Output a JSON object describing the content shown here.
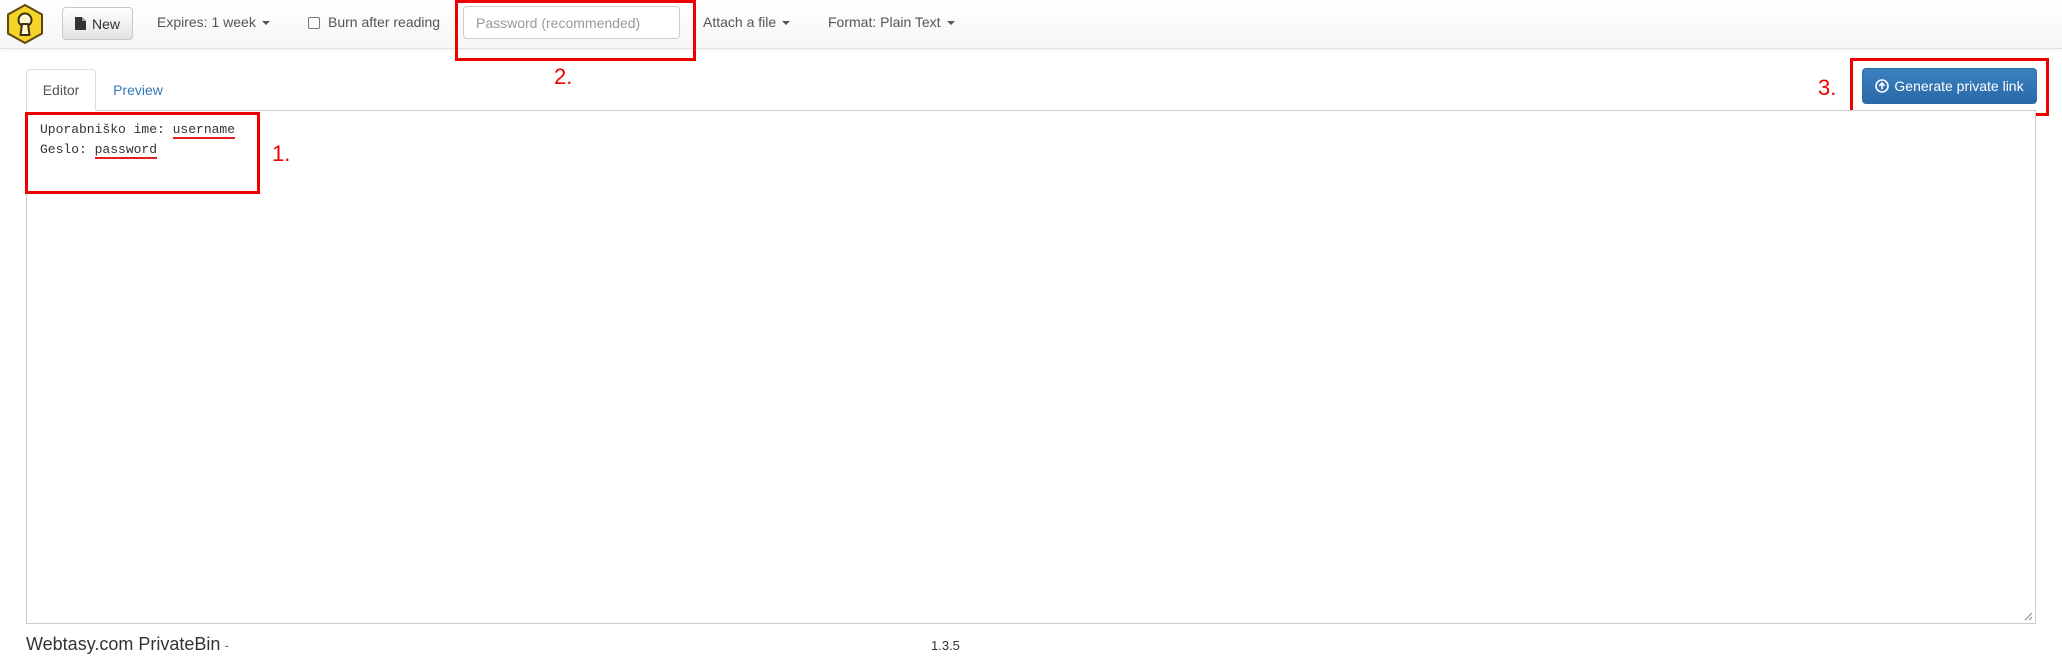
{
  "navbar": {
    "new_label": "New",
    "expires_label": "Expires: 1 week",
    "burn_label": "Burn after reading",
    "burn_checked": false,
    "password_placeholder": "Password (recommended)",
    "attach_label": "Attach a file",
    "format_label": "Format: Plain Text"
  },
  "tabs": {
    "editor": "Editor",
    "preview": "Preview"
  },
  "generate_label": "Generate private link",
  "editor": {
    "line1_prefix": "Uporabniško ime: ",
    "line1_value": "username",
    "line2_prefix": "Geslo: ",
    "line2_value": "password"
  },
  "annotations": {
    "n1": "1.",
    "n2": "2.",
    "n3": "3.",
    "color": "#ee0000"
  },
  "footer": {
    "brand": "Webtasy.com PrivateBin",
    "dash": "-",
    "version": "1.3.5"
  },
  "icons": {
    "logo": "keyhole-logo-icon",
    "new": "document-icon",
    "generate": "upload-circle-icon"
  },
  "colors": {
    "primary": "#337ab7",
    "logo_yellow": "#f5d328"
  }
}
